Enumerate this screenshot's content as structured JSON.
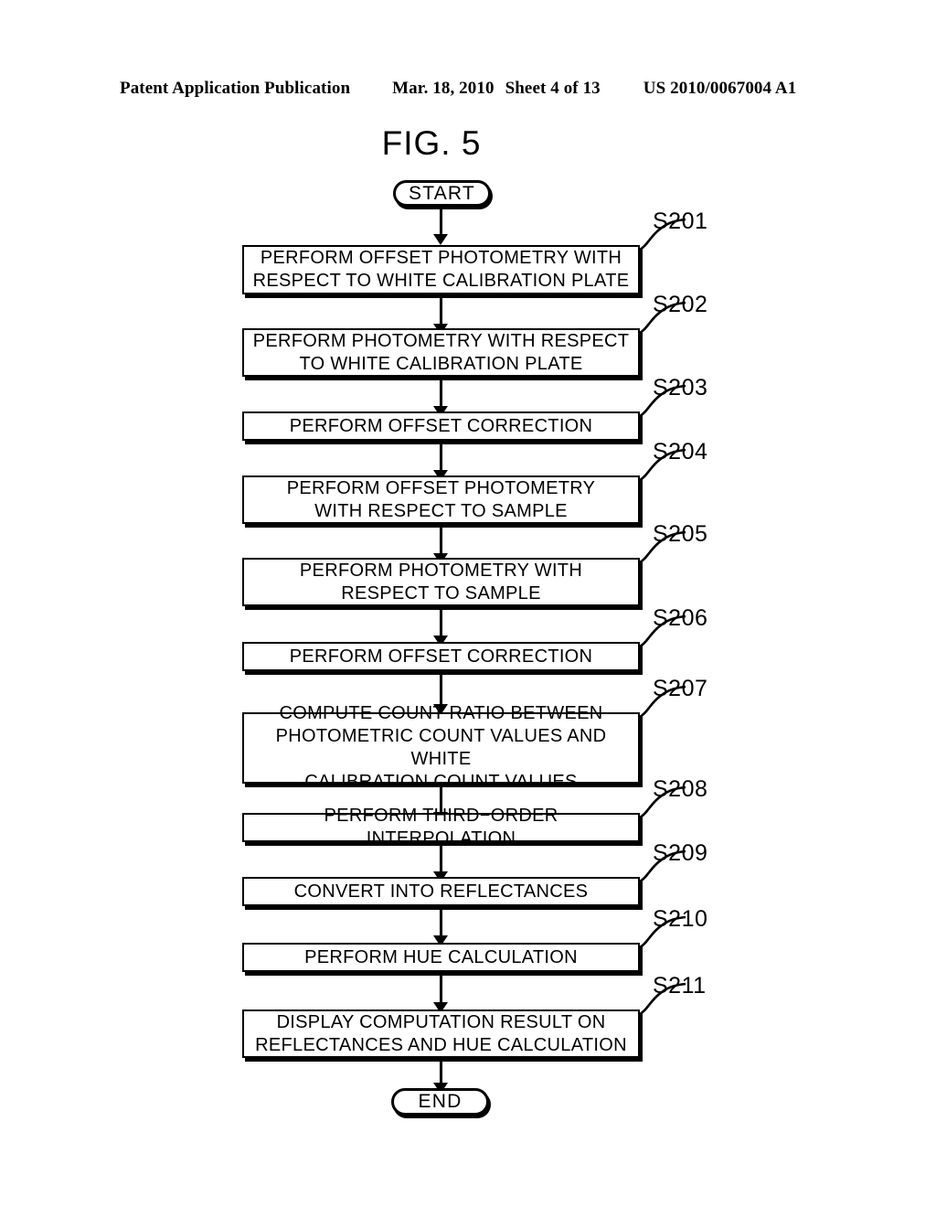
{
  "header": {
    "publication": "Patent Application Publication",
    "date": "Mar. 18, 2010",
    "sheet": "Sheet 4 of 13",
    "pub_number": "US 2010/0067004 A1"
  },
  "figure": {
    "title": "FIG. 5"
  },
  "flowchart": {
    "start_label": "START",
    "end_label": "END",
    "steps": [
      {
        "ref": "S201",
        "text": "PERFORM OFFSET PHOTOMETRY WITH\nRESPECT TO WHITE CALIBRATION PLATE"
      },
      {
        "ref": "S202",
        "text": "PERFORM PHOTOMETRY WITH RESPECT\nTO WHITE CALIBRATION PLATE"
      },
      {
        "ref": "S203",
        "text": "PERFORM OFFSET CORRECTION"
      },
      {
        "ref": "S204",
        "text": "PERFORM OFFSET PHOTOMETRY\nWITH RESPECT TO SAMPLE"
      },
      {
        "ref": "S205",
        "text": "PERFORM PHOTOMETRY WITH\nRESPECT TO SAMPLE"
      },
      {
        "ref": "S206",
        "text": "PERFORM OFFSET CORRECTION"
      },
      {
        "ref": "S207",
        "text": "COMPUTE COUNT RATIO BETWEEN\nPHOTOMETRIC COUNT VALUES AND WHITE\nCALIBRATION COUNT VALUES"
      },
      {
        "ref": "S208",
        "text": "PERFORM THIRD−ORDER INTERPOLATION"
      },
      {
        "ref": "S209",
        "text": "CONVERT INTO REFLECTANCES"
      },
      {
        "ref": "S210",
        "text": "PERFORM HUE CALCULATION"
      },
      {
        "ref": "S211",
        "text": "DISPLAY COMPUTATION RESULT ON\nREFLECTANCES AND HUE CALCULATION"
      }
    ]
  },
  "colors": {
    "ink": "#000000",
    "paper": "#ffffff"
  }
}
